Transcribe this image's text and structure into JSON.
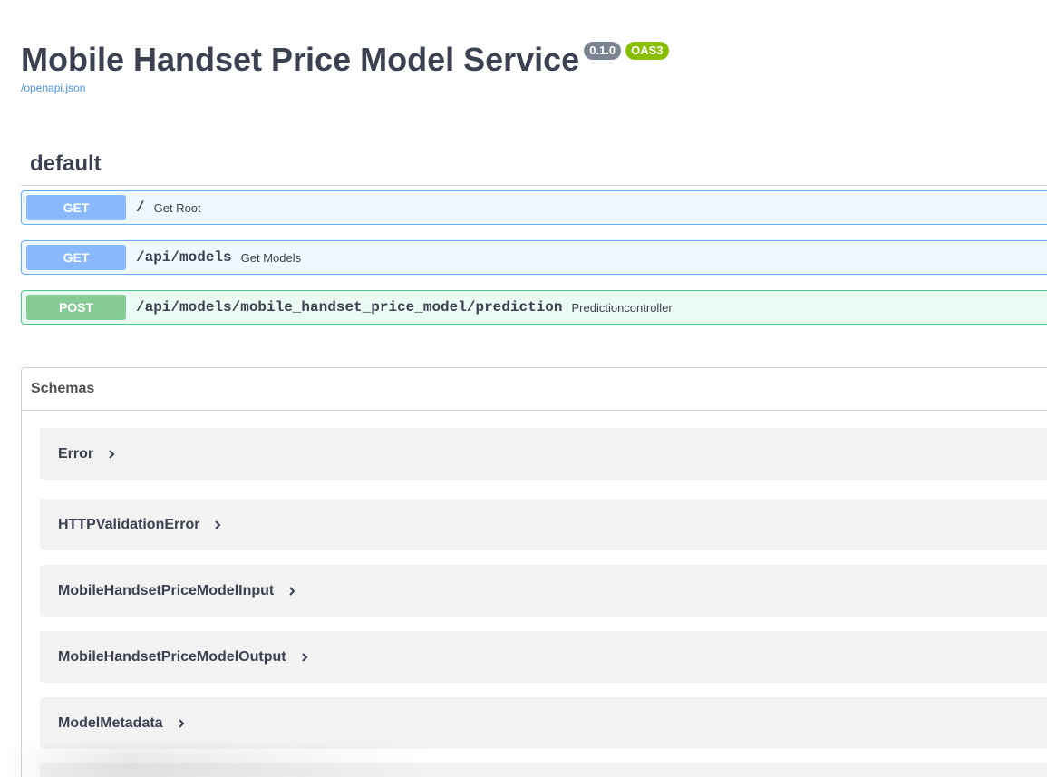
{
  "info": {
    "title": "Mobile Handset Price Model Service",
    "version": "0.1.0",
    "oas_badge": "OAS3",
    "spec_link": "/openapi.json"
  },
  "tag": {
    "name": "default"
  },
  "operations": [
    {
      "method": "GET",
      "path": "/",
      "summary": "Get Root"
    },
    {
      "method": "GET",
      "path": "/api/models",
      "summary": "Get Models"
    },
    {
      "method": "POST",
      "path": "/api/models/mobile_handset_price_model/prediction",
      "summary": "Predictioncontroller"
    }
  ],
  "schemas": {
    "title": "Schemas",
    "items": [
      {
        "name": "Error"
      },
      {
        "name": "HTTPValidationError"
      },
      {
        "name": "MobileHandsetPriceModelInput"
      },
      {
        "name": "MobileHandsetPriceModelOutput"
      },
      {
        "name": "ModelMetadata"
      }
    ]
  },
  "colors": {
    "get": "#61affe",
    "post": "#49cc90",
    "link": "#4990e2",
    "text": "#3b4151"
  },
  "icons": {
    "model_toggle": "chevron-right-icon"
  }
}
